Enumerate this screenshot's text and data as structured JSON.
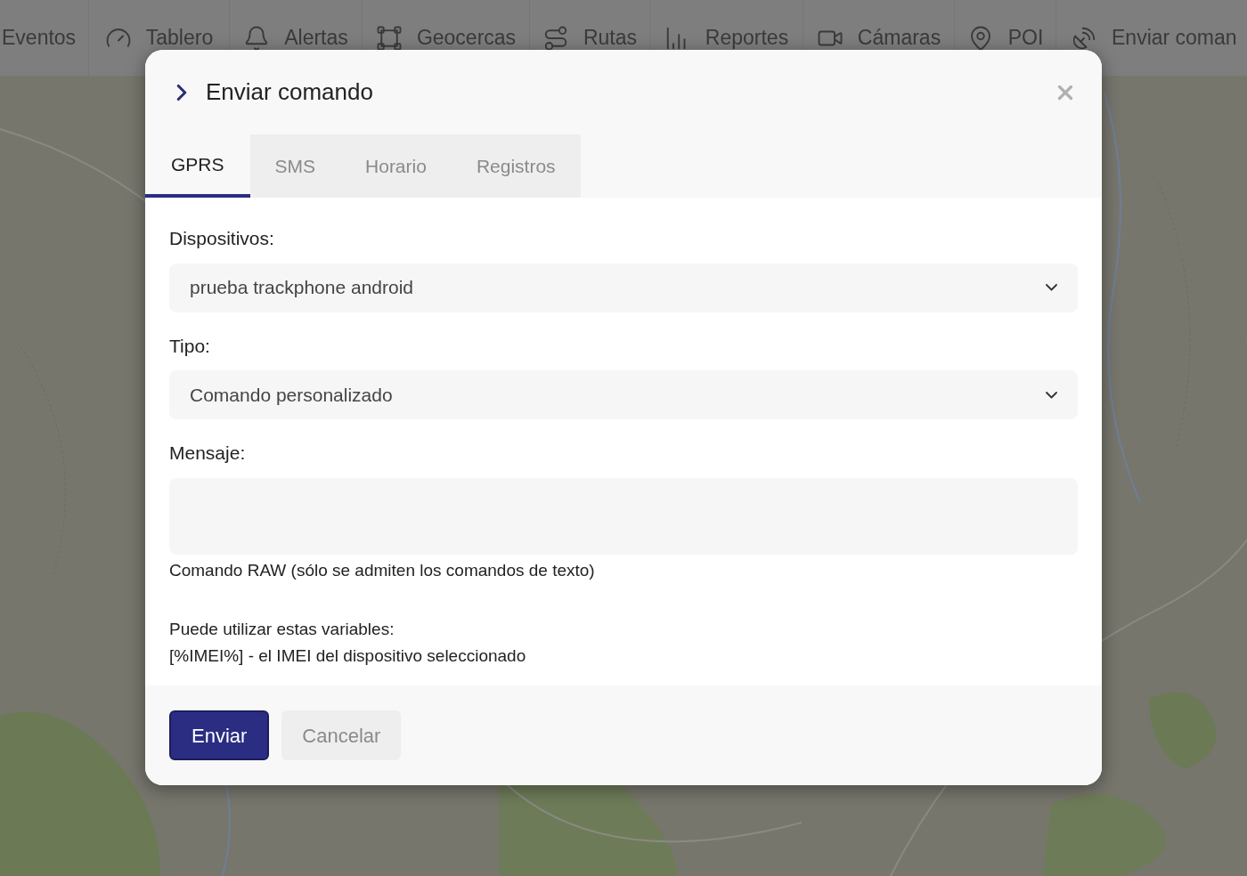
{
  "nav": [
    {
      "label": "Eventos"
    },
    {
      "label": "Tablero"
    },
    {
      "label": "Alertas"
    },
    {
      "label": "Geocercas"
    },
    {
      "label": "Rutas"
    },
    {
      "label": "Reportes"
    },
    {
      "label": "Cámaras"
    },
    {
      "label": "POI"
    },
    {
      "label": "Enviar coman"
    }
  ],
  "modal": {
    "title": "Enviar comando",
    "tabs": [
      {
        "label": "GPRS",
        "selected": true
      },
      {
        "label": "SMS",
        "selected": false
      },
      {
        "label": "Horario",
        "selected": false
      },
      {
        "label": "Registros",
        "selected": false
      }
    ],
    "fields": [
      {
        "kind": "select",
        "label": "Dispositivos:",
        "value": "prueba trackphone android"
      },
      {
        "kind": "select",
        "label": "Tipo:",
        "value": "Comando personalizado"
      },
      {
        "kind": "textarea",
        "label": "Mensaje:",
        "help": "Comando RAW (sólo se admiten los comandos de texto)"
      }
    ],
    "notes": [
      "Puede utilizar estas variables:",
      "[%IMEI%] - el IMEI del dispositivo seleccionado"
    ],
    "buttons": [
      {
        "kind": "primary",
        "label": "Enviar"
      },
      {
        "kind": "secondary",
        "label": "Cancelar"
      }
    ]
  }
}
